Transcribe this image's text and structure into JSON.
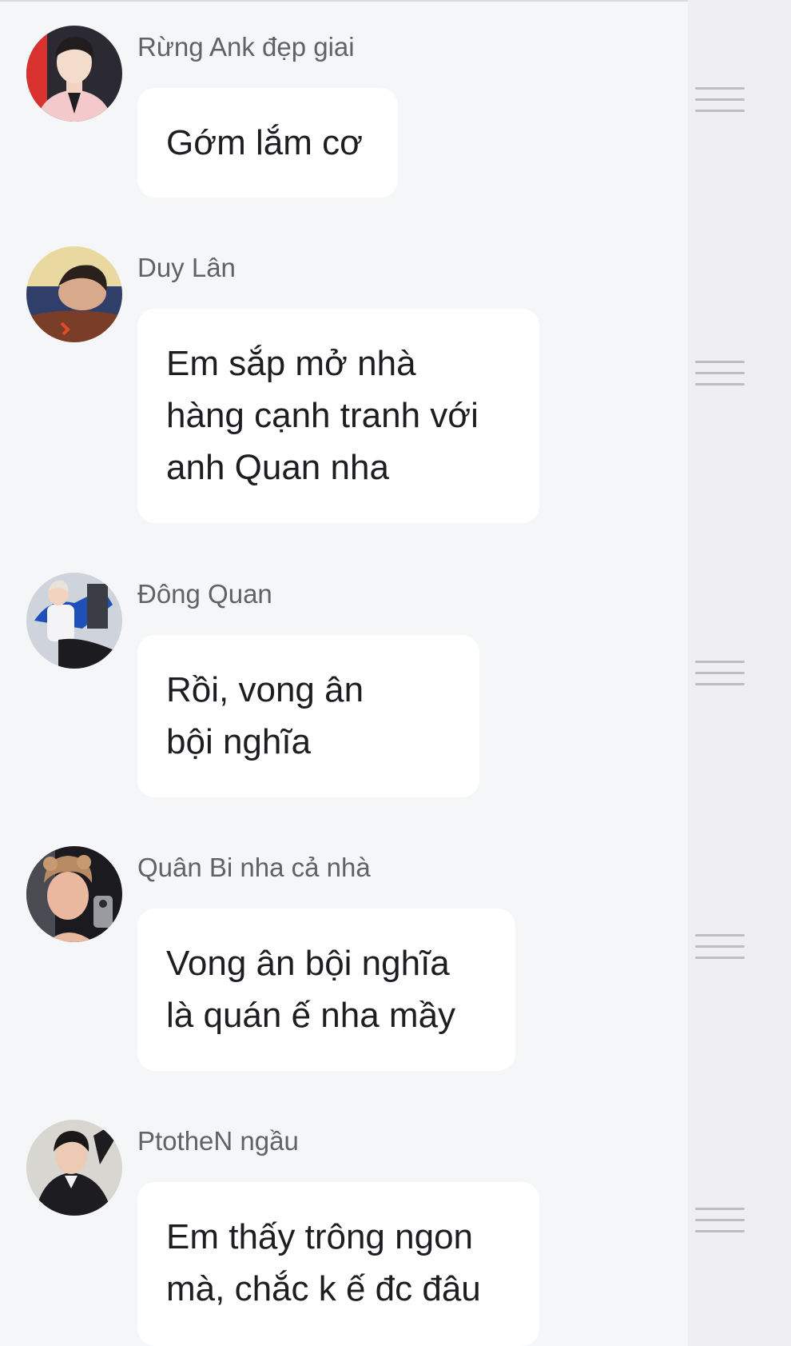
{
  "comments": [
    {
      "sender": "Rừng Ank đẹp giai",
      "message": "Gớm lắm cơ",
      "avatar_icon": "avatar-boy-pink-jacket"
    },
    {
      "sender": "Duy Lân",
      "message": "Em sắp mở nhà\nhàng cạnh tranh với\nanh Quan nha",
      "avatar_icon": "avatar-boy-sleeping"
    },
    {
      "sender": "Đông Quan",
      "message": "Rồi, vong ân\nbội nghĩa",
      "avatar_icon": "avatar-boy-blue-jacket"
    },
    {
      "sender": "Quân Bi nha cả nhà",
      "message": "Vong ân bội nghĩa\nlà quán ế nha mầy",
      "avatar_icon": "avatar-boy-curly-hair"
    },
    {
      "sender": "PtotheN ngầu",
      "message": "Em thấy trông ngon\nmà, chắc k ế đc đâu",
      "avatar_icon": "avatar-boy-black-outfit"
    }
  ],
  "menu_icon": "drag-handle-icon"
}
